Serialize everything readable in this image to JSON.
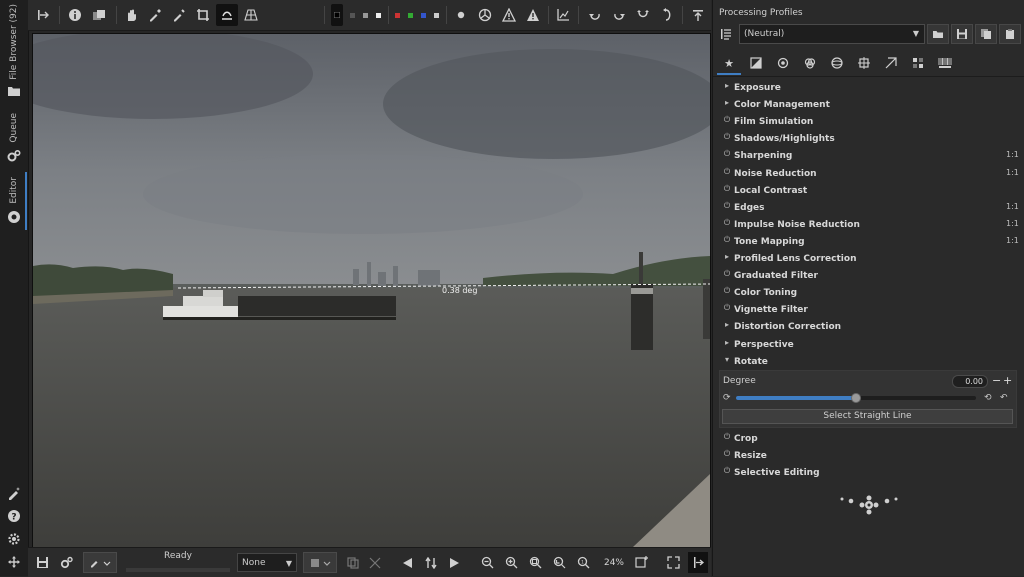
{
  "left_tabs": {
    "file_browser": "File Browser (92)",
    "queue": "Queue",
    "editor": "Editor"
  },
  "image": {
    "angle_label": "0.38 deg"
  },
  "bottom_toolbar": {
    "status": "Ready",
    "preview_mode": "None",
    "zoom": "24%"
  },
  "right_panel": {
    "title": "Processing Profiles",
    "profile": "(Neutral)",
    "tools_top": [
      {
        "name": "Exposure",
        "marker": "▸",
        "badge": ""
      },
      {
        "name": "Color Management",
        "marker": "▸",
        "badge": ""
      },
      {
        "name": "Film Simulation",
        "marker": "⏻",
        "badge": ""
      },
      {
        "name": "Shadows/Highlights",
        "marker": "⏻",
        "badge": ""
      },
      {
        "name": "Sharpening",
        "marker": "⏻",
        "badge": "1:1"
      },
      {
        "name": "Noise Reduction",
        "marker": "⏻",
        "badge": "1:1"
      },
      {
        "name": "Local Contrast",
        "marker": "⏻",
        "badge": ""
      },
      {
        "name": "Edges",
        "marker": "⏻",
        "badge": "1:1"
      },
      {
        "name": "Impulse Noise Reduction",
        "marker": "⏻",
        "badge": "1:1"
      },
      {
        "name": "Tone Mapping",
        "marker": "⏻",
        "badge": "1:1"
      },
      {
        "name": "Profiled Lens Correction",
        "marker": "▸",
        "badge": ""
      },
      {
        "name": "Graduated Filter",
        "marker": "⏻",
        "badge": ""
      },
      {
        "name": "Color Toning",
        "marker": "⏻",
        "badge": ""
      },
      {
        "name": "Vignette Filter",
        "marker": "⏻",
        "badge": ""
      },
      {
        "name": "Distortion Correction",
        "marker": "▸",
        "badge": ""
      },
      {
        "name": "Perspective",
        "marker": "▸",
        "badge": ""
      },
      {
        "name": "Rotate",
        "marker": "▾",
        "badge": ""
      }
    ],
    "rotate": {
      "degree_label": "Degree",
      "degree_value": "0.00",
      "slider_fraction": 0.5,
      "select_line_button": "Select Straight Line"
    },
    "tools_bottom": [
      {
        "name": "Crop",
        "marker": "⏻",
        "badge": ""
      },
      {
        "name": "Resize",
        "marker": "⏻",
        "badge": ""
      },
      {
        "name": "Selective Editing",
        "marker": "⏻",
        "badge": ""
      }
    ],
    "accent_color": "#3f7ec4"
  }
}
